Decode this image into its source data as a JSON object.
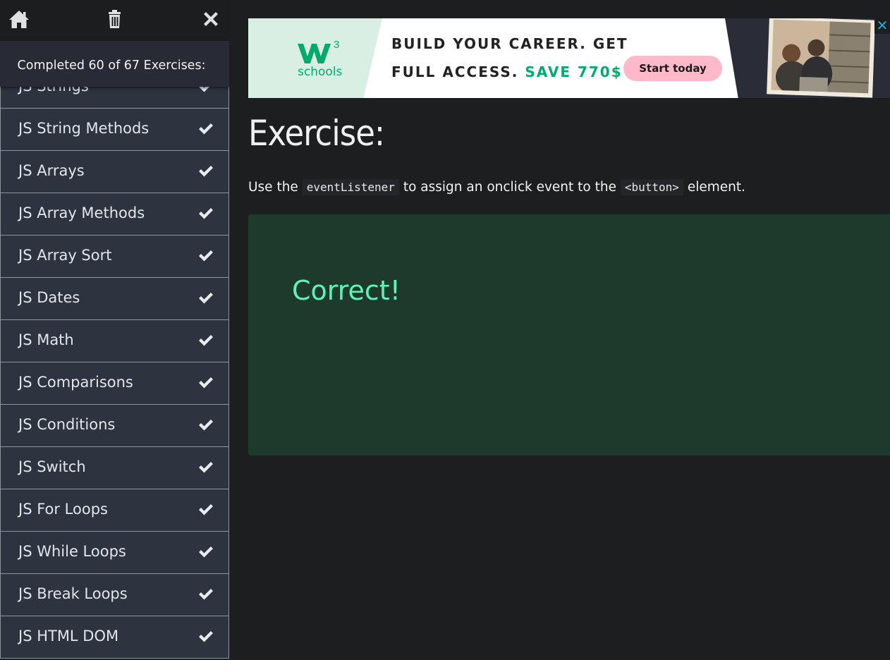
{
  "toolbar": {
    "home_icon": "home-icon",
    "trash_icon": "trash-icon",
    "close_icon": "close-icon"
  },
  "progress": {
    "text": "Completed 60 of 67 Exercises:",
    "completed": 60,
    "total": 67
  },
  "sidebar": {
    "items": [
      {
        "label": "JS Strings",
        "done": true
      },
      {
        "label": "JS String Methods",
        "done": true
      },
      {
        "label": "JS Arrays",
        "done": true
      },
      {
        "label": "JS Array Methods",
        "done": true
      },
      {
        "label": "JS Array Sort",
        "done": true
      },
      {
        "label": "JS Dates",
        "done": true
      },
      {
        "label": "JS Math",
        "done": true
      },
      {
        "label": "JS Comparisons",
        "done": true
      },
      {
        "label": "JS Conditions",
        "done": true
      },
      {
        "label": "JS Switch",
        "done": true
      },
      {
        "label": "JS For Loops",
        "done": true
      },
      {
        "label": "JS While Loops",
        "done": true
      },
      {
        "label": "JS Break Loops",
        "done": true
      },
      {
        "label": "JS HTML DOM",
        "done": true
      }
    ]
  },
  "ad": {
    "logo_text": "schools",
    "logo_superscript": "3",
    "line1": "BUILD YOUR CAREER. GET",
    "line2_prefix": "FULL ACCESS.",
    "line2_highlight": "SAVE 770$",
    "cta": "Start today",
    "close_label": "✕"
  },
  "exercise": {
    "heading": "Exercise:",
    "instruction_part1": "Use the",
    "code1": "eventListener",
    "instruction_part2": "to assign an onclick event to the",
    "code2": "<button>",
    "instruction_part3": "element.",
    "result": "Correct!"
  },
  "colors": {
    "sidebar_item_bg": "#2d3440",
    "result_bg": "#1d3a2c",
    "result_text": "#5df5b4",
    "brand_green": "#04aa6d"
  }
}
